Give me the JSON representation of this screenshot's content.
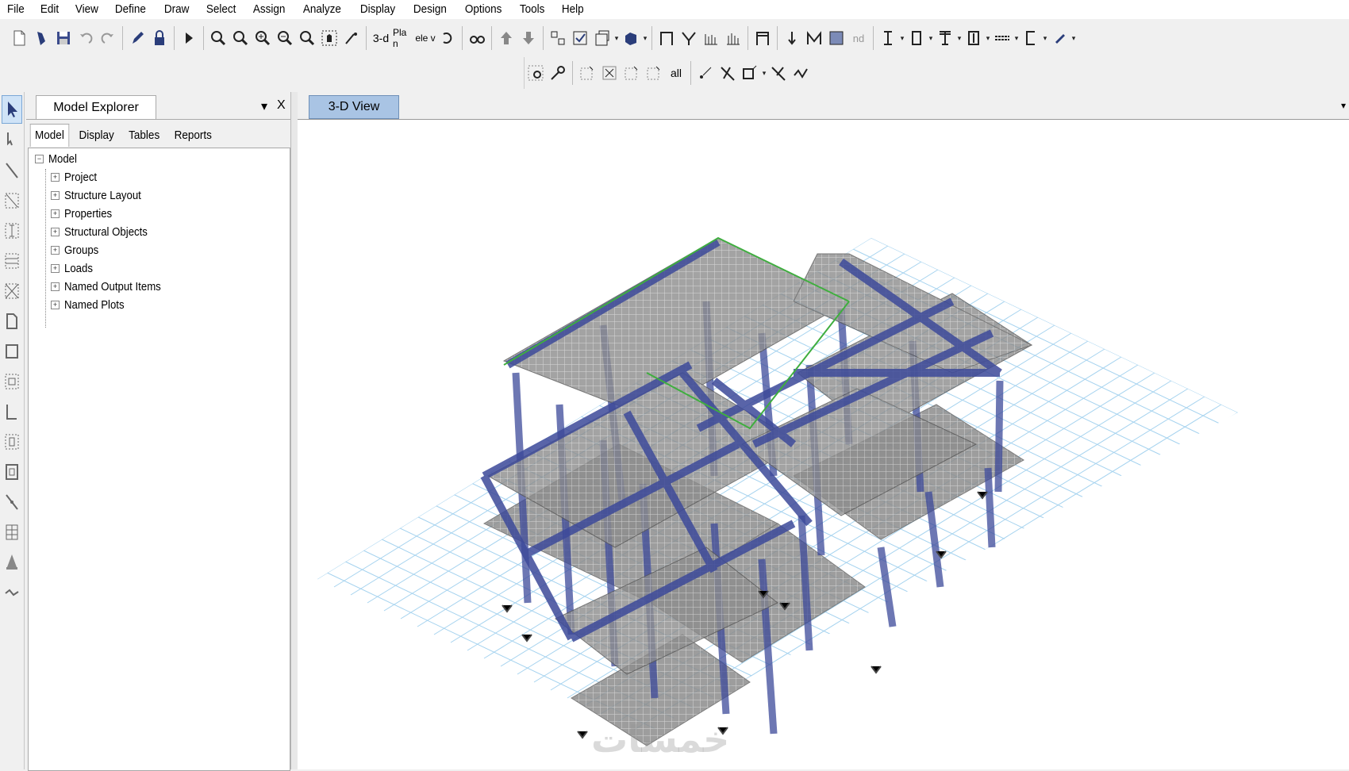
{
  "menu": [
    "File",
    "Edit",
    "View",
    "Define",
    "Draw",
    "Select",
    "Assign",
    "Analyze",
    "Display",
    "Design",
    "Options",
    "Tools",
    "Help"
  ],
  "toolbar1": {
    "text_buttons": {
      "three_d": "3-d",
      "plan": "Pla n",
      "elevation": "ele v",
      "nd": "nd"
    },
    "icons": [
      "new-model-icon",
      "open-icon",
      "save-icon",
      "undo-icon",
      "redo-icon",
      "pencil-icon",
      "lock-icon",
      "run-analysis-icon",
      "zoom-rubber-band-icon",
      "zoom-restore-icon",
      "zoom-in-icon",
      "zoom-out-icon",
      "zoom-previous-icon",
      "pan-icon",
      "rotate-icon"
    ]
  },
  "toolbar2": {
    "all_label": "all"
  },
  "explorer": {
    "title": "Model Explorer",
    "close": "X",
    "dropdown": "▾",
    "tabs": [
      "Model",
      "Display",
      "Tables",
      "Reports"
    ],
    "root": "Model",
    "items": [
      "Project",
      "Structure Layout",
      "Properties",
      "Structural Objects",
      "Groups",
      "Loads",
      "Named Output Items",
      "Named Plots"
    ]
  },
  "view": {
    "tab_label": "3-D View",
    "dropdown": "▾"
  },
  "watermark": "خمسات",
  "colors": {
    "beam": "#3d4a9a",
    "grid": "#a6d3ef",
    "slab": "#8a8a8a",
    "highlight": "#3fae3f",
    "active_tab": "#a9c4e4"
  }
}
